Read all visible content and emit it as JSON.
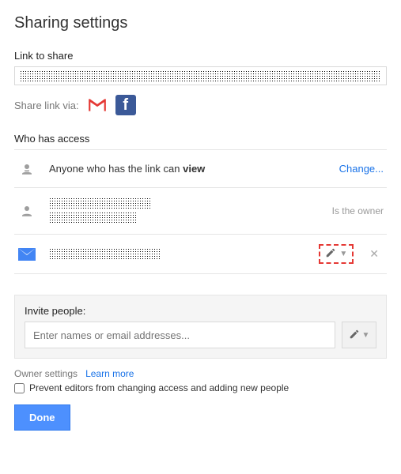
{
  "title": "Sharing settings",
  "link_to_share_label": "Link to share",
  "share_link_via_label": "Share link via:",
  "who_has_access_label": "Who has access",
  "access": {
    "public": {
      "text_prefix": "Anyone who has the link can ",
      "permission": "view",
      "change_label": "Change..."
    },
    "owner": {
      "role_label": "Is the owner"
    },
    "collaborator": {
      "permission_icon": "pencil-icon"
    }
  },
  "invite": {
    "label": "Invite people:",
    "placeholder": "Enter names or email addresses..."
  },
  "owner_settings": {
    "label": "Owner settings",
    "learn_more": "Learn more",
    "checkbox_label": "Prevent editors from changing access and adding new people"
  },
  "done_label": "Done"
}
